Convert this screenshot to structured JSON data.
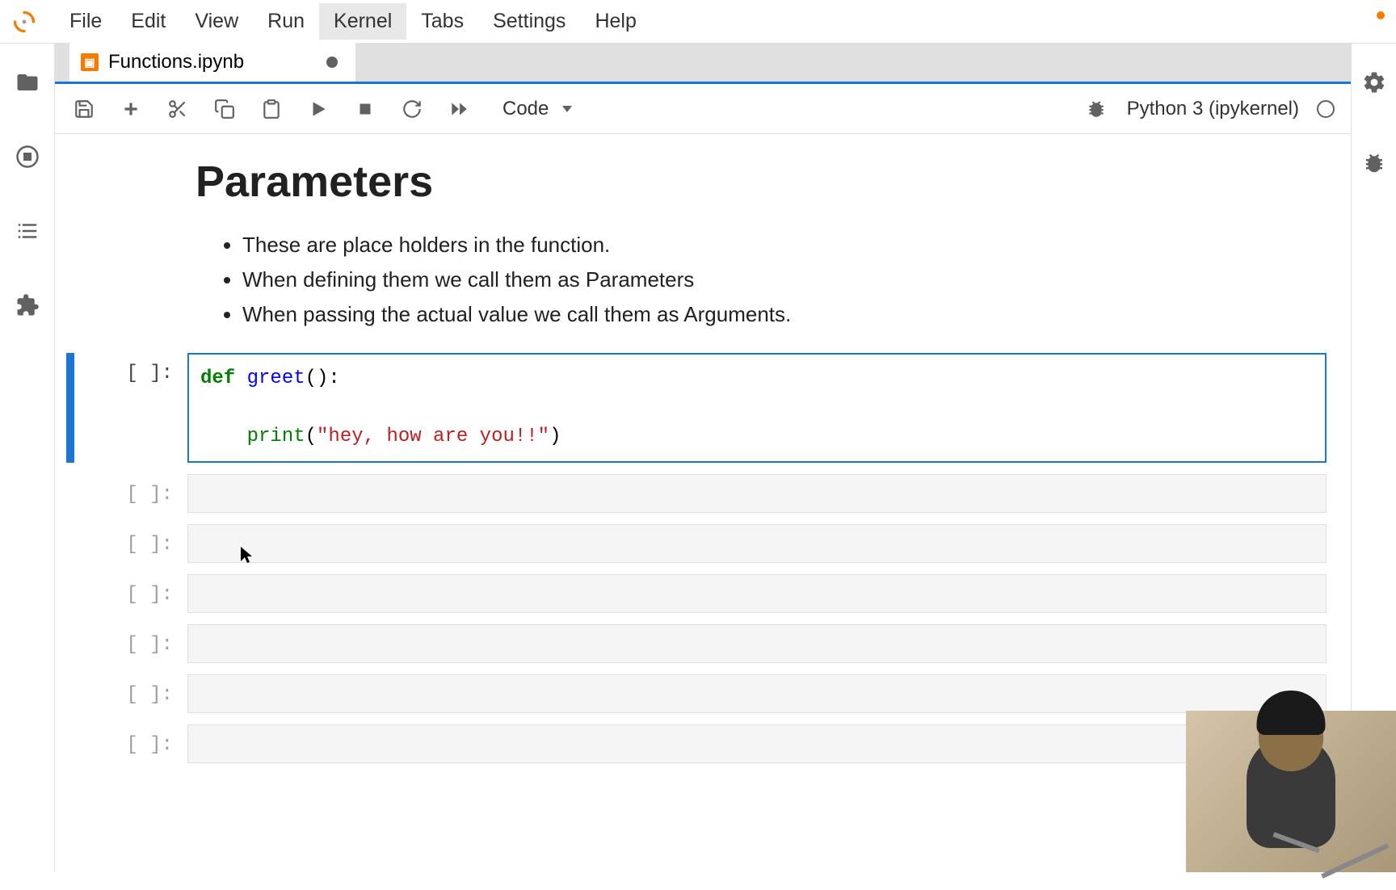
{
  "menu": {
    "items": [
      "File",
      "Edit",
      "View",
      "Run",
      "Kernel",
      "Tabs",
      "Settings",
      "Help"
    ],
    "hovered_index": 4
  },
  "tab": {
    "filename": "Functions.ipynb",
    "dirty": true
  },
  "toolbar": {
    "cell_type": "Code",
    "kernel_label": "Python 3 (ipykernel)"
  },
  "markdown": {
    "title": "Parameters",
    "bullets": [
      "These are place holders in the function.",
      "When defining them we call them as Parameters",
      "When passing the actual value we call them as Arguments."
    ]
  },
  "cells": [
    {
      "prompt": "[ ]:",
      "selected": true,
      "code_tokens": [
        {
          "cls": "kw",
          "t": "def "
        },
        {
          "cls": "fn",
          "t": "greet"
        },
        {
          "cls": "",
          "t": "():"
        },
        {
          "cls": "",
          "t": "\n"
        },
        {
          "cls": "",
          "t": "\n"
        },
        {
          "cls": "",
          "t": "    "
        },
        {
          "cls": "bi",
          "t": "print"
        },
        {
          "cls": "",
          "t": "("
        },
        {
          "cls": "str",
          "t": "\"hey, how are you!!\""
        },
        {
          "cls": "",
          "t": ")"
        }
      ]
    },
    {
      "prompt": "[ ]:",
      "selected": false,
      "code_tokens": []
    },
    {
      "prompt": "[ ]:",
      "selected": false,
      "code_tokens": []
    },
    {
      "prompt": "[ ]:",
      "selected": false,
      "code_tokens": []
    },
    {
      "prompt": "[ ]:",
      "selected": false,
      "code_tokens": []
    },
    {
      "prompt": "[ ]:",
      "selected": false,
      "code_tokens": []
    },
    {
      "prompt": "[ ]:",
      "selected": false,
      "code_tokens": []
    }
  ]
}
